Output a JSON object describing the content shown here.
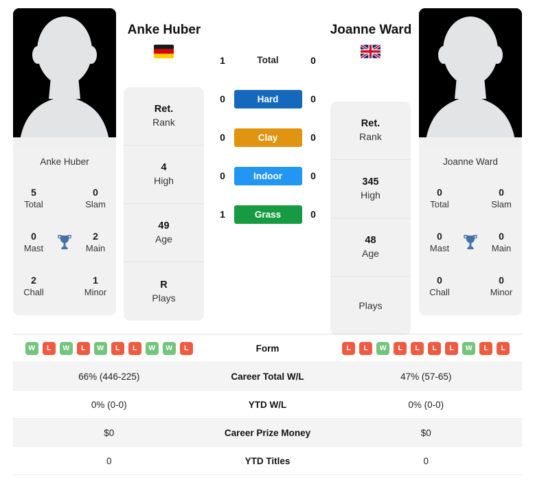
{
  "players": {
    "left": {
      "name": "Anke Huber",
      "photo_caption": "Anke Huber",
      "flag_name": "germany-flag",
      "titles": [
        {
          "value": "5",
          "label": "Total"
        },
        {
          "value": "0",
          "label": "Slam"
        },
        {
          "value": "0",
          "label": "Mast"
        },
        {
          "value": "2",
          "label": "Main"
        },
        {
          "value": "2",
          "label": "Chall"
        },
        {
          "value": "1",
          "label": "Minor"
        }
      ],
      "info": [
        {
          "value": "Ret.",
          "label": "Rank"
        },
        {
          "value": "4",
          "label": "High"
        },
        {
          "value": "49",
          "label": "Age"
        },
        {
          "value": "R",
          "label": "Plays"
        }
      ]
    },
    "right": {
      "name": "Joanne Ward",
      "photo_caption": "Joanne Ward",
      "flag_name": "united-kingdom-flag",
      "titles": [
        {
          "value": "0",
          "label": "Total"
        },
        {
          "value": "0",
          "label": "Slam"
        },
        {
          "value": "0",
          "label": "Mast"
        },
        {
          "value": "0",
          "label": "Main"
        },
        {
          "value": "0",
          "label": "Chall"
        },
        {
          "value": "0",
          "label": "Minor"
        }
      ],
      "info": [
        {
          "value": "Ret.",
          "label": "Rank"
        },
        {
          "value": "345",
          "label": "High"
        },
        {
          "value": "48",
          "label": "Age"
        },
        {
          "value": "",
          "label": "Plays"
        }
      ]
    }
  },
  "h2h": {
    "total": {
      "label": "Total",
      "left": "1",
      "right": "0"
    },
    "surfaces": [
      {
        "label": "Hard",
        "left": "0",
        "right": "0",
        "color": "#1569bd"
      },
      {
        "label": "Clay",
        "left": "0",
        "right": "0",
        "color": "#e09410"
      },
      {
        "label": "Indoor",
        "left": "0",
        "right": "0",
        "color": "#2196f3"
      },
      {
        "label": "Grass",
        "left": "1",
        "right": "0",
        "color": "#169b42"
      }
    ]
  },
  "stats_table": {
    "rows": [
      {
        "label": "Form",
        "type": "form",
        "left_form": [
          "W",
          "L",
          "W",
          "L",
          "W",
          "L",
          "L",
          "W",
          "W",
          "L"
        ],
        "right_form": [
          "L",
          "L",
          "W",
          "L",
          "L",
          "L",
          "L",
          "W",
          "L",
          "L"
        ]
      },
      {
        "label": "Career Total W/L",
        "type": "text",
        "left": "66% (446-225)",
        "right": "47% (57-65)"
      },
      {
        "label": "YTD W/L",
        "type": "text",
        "left": "0% (0-0)",
        "right": "0% (0-0)"
      },
      {
        "label": "Career Prize Money",
        "type": "text",
        "left": "$0",
        "right": "$0"
      },
      {
        "label": "YTD Titles",
        "type": "text",
        "left": "0",
        "right": "0"
      }
    ]
  },
  "colors": {
    "win": "#74c47e",
    "loss": "#ef5a41",
    "trophy": "#4471a8",
    "card_bg": "#f1f1f1"
  }
}
